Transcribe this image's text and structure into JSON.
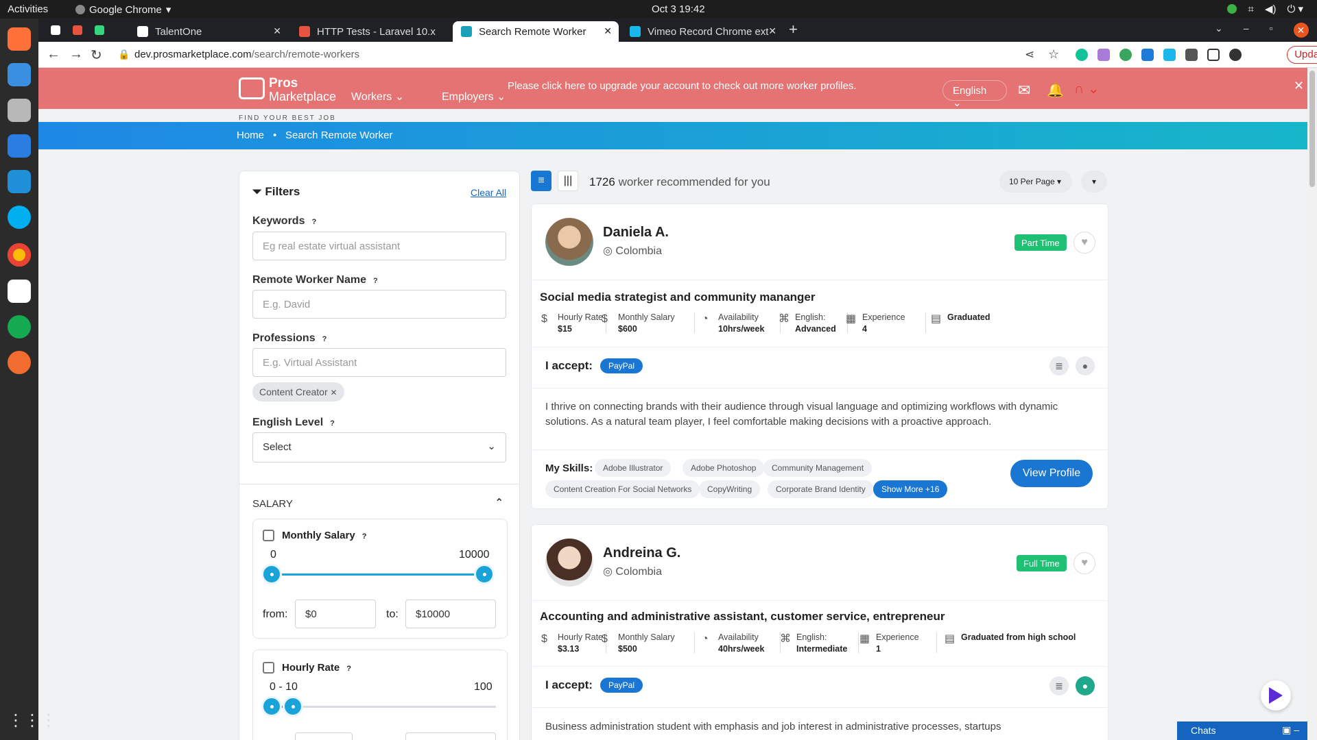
{
  "os": {
    "activities": "Activities",
    "app": "Google Chrome",
    "clock": "Oct 3  19:42"
  },
  "tabs": [
    {
      "label": "TalentOne",
      "color": "#ffffff"
    },
    {
      "label": "HTTP Tests - Laravel 10.x",
      "color": "#e8533f"
    },
    {
      "label": "Search Remote Worker",
      "color": "#17a2b8"
    },
    {
      "label": "Vimeo Record Chrome ext",
      "color": "#1ab7ea"
    }
  ],
  "url": {
    "host": "dev.prosmarketplace.com",
    "path": "/search/remote-workers"
  },
  "update_label": "Update",
  "header": {
    "logo_line1": "Pros",
    "logo_line2": "Marketplace",
    "tagline": "FIND YOUR BEST JOB",
    "menu_workers": "Workers",
    "menu_employers": "Employers",
    "upgrade_msg": "Please click here to upgrade your account to check out more worker profiles.",
    "language": "English"
  },
  "breadcrumb": {
    "home": "Home",
    "current": "Search Remote Worker"
  },
  "filters": {
    "title": "Filters",
    "clear": "Clear All",
    "keywords_label": "Keywords",
    "keywords_ph": "Eg real estate virtual assistant",
    "name_label": "Remote Worker Name",
    "name_ph": "E.g. David",
    "prof_label": "Professions",
    "prof_ph": "E.g. Virtual Assistant",
    "prof_chip": "Content Creator",
    "english_label": "English Level",
    "english_value": "Select",
    "salary_title": "SALARY",
    "monthly": {
      "label": "Monthly Salary",
      "min": "0",
      "max": "10000",
      "from_label": "from:",
      "to_label": "to:",
      "from": "$0",
      "to": "$10000"
    },
    "hourly": {
      "label": "Hourly Rate",
      "range": "0 - 10",
      "max": "100"
    }
  },
  "results": {
    "count": "1726",
    "count_suffix": "worker recommended for you",
    "per_page": "10 Per Page"
  },
  "workers": [
    {
      "name": "Daniela A.",
      "country": "Colombia",
      "type": "Part Time",
      "headline": "Social media strategist and community mananger",
      "hourly_label": "Hourly Rate",
      "hourly": "$15",
      "monthly_label": "Monthly Salary",
      "monthly": "$600",
      "avail_label": "Availability",
      "avail": "10hrs/week",
      "eng_label": "English:",
      "eng": "Advanced",
      "exp_label": "Experience",
      "exp": "4",
      "edu": "Graduated",
      "accept": "I accept:",
      "pay": "PayPal",
      "bio": "I thrive on connecting brands with their audience through visual language and optimizing workflows with dynamic solutions. As a natural team player, I feel comfortable making decisions with a proactive approach.",
      "skills_label": "My Skills:",
      "skills": [
        "Adobe Illustrator",
        "Adobe Photoshop",
        "Community Management",
        "Content Creation For Social Networks",
        "CopyWriting",
        "Corporate Brand Identity"
      ],
      "more": "Show More +16",
      "view": "View Profile"
    },
    {
      "name": "Andreina G.",
      "country": "Colombia",
      "type": "Full Time",
      "headline": "Accounting and administrative assistant, customer service, entrepreneur",
      "hourly_label": "Hourly Rate",
      "hourly": "$3.13",
      "monthly_label": "Monthly Salary",
      "monthly": "$500",
      "avail_label": "Availability",
      "avail": "40hrs/week",
      "eng_label": "English:",
      "eng": "Intermediate",
      "exp_label": "Experience",
      "exp": "1",
      "edu": "Graduated from high school",
      "accept": "I accept:",
      "pay": "PayPal",
      "bio": "Business administration student with emphasis and job interest in administrative processes, startups"
    }
  ],
  "chats": "Chats"
}
